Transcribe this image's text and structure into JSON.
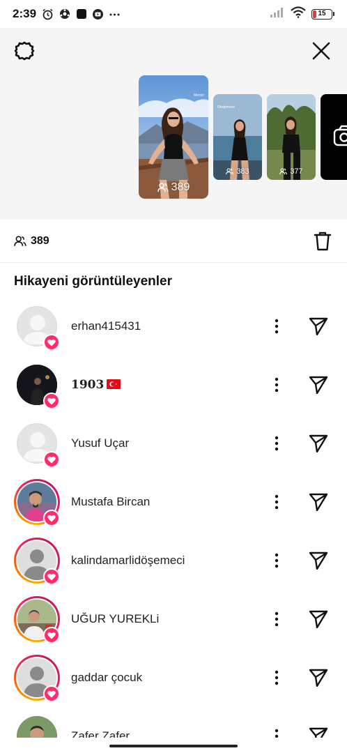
{
  "status_bar": {
    "time": "2:39",
    "battery": "15",
    "icons": [
      "alarm-icon",
      "ball-icon",
      "app-icon",
      "tv-icon",
      "more-dots-icon",
      "signal-icon",
      "wifi-icon",
      "battery-icon"
    ]
  },
  "header": {
    "settings_icon": "gear-icon",
    "close_icon": "close-icon"
  },
  "stories": [
    {
      "views": "389",
      "label": "Mersin",
      "selected": true
    },
    {
      "views": "383",
      "label": "Oksijenone"
    },
    {
      "views": "377",
      "label": ""
    },
    {
      "icon": "camera-icon"
    }
  ],
  "summary": {
    "view_count": "389",
    "trash_icon": "trash-icon"
  },
  "section_title": "Hikayeni görüntüleyenler",
  "viewers": [
    {
      "name": "erhan415431",
      "avatar": "default",
      "ring": false,
      "liked": true
    },
    {
      "name": "1903",
      "flag": "turkey-flag-icon",
      "avatar": "photo-night",
      "ring": false,
      "liked": true
    },
    {
      "name": "Yusuf Uçar",
      "avatar": "default",
      "ring": false,
      "liked": true
    },
    {
      "name": "Mustafa Bircan",
      "avatar": "photo-man",
      "ring": true,
      "liked": true
    },
    {
      "name": "kalindamarlidöşemeci",
      "avatar": "default-gray",
      "ring": true,
      "liked": true
    },
    {
      "name": "UĞUR YUREKLi",
      "avatar": "photo-man-2",
      "ring": true,
      "liked": true
    },
    {
      "name": "gaddar çocuk",
      "avatar": "default-gray",
      "ring": true,
      "liked": true
    },
    {
      "name": "Zafer Zafer",
      "avatar": "photo-man-3",
      "ring": false,
      "liked": false
    }
  ],
  "colors": {
    "heart_badge": "#ff2d6b",
    "top_area_bg": "#f5f5f5",
    "ring_gradient": [
      "#ffb300",
      "#e91e63"
    ]
  }
}
